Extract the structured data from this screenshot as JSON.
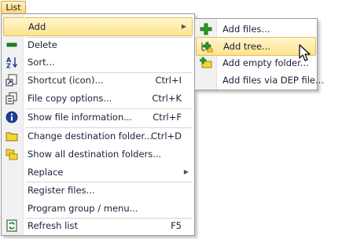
{
  "menubar": {
    "title": "List"
  },
  "menu": {
    "items": [
      {
        "label": "Add",
        "icon": "",
        "shortcut": "",
        "submenu": true,
        "highlighted": true
      },
      {
        "label": "Delete",
        "icon": "minus-icon",
        "shortcut": ""
      },
      {
        "label": "Sort...",
        "icon": "sort-az-icon",
        "shortcut": ""
      },
      {
        "label": "Shortcut (icon)...",
        "icon": "shortcut-icon",
        "shortcut": "Ctrl+I"
      },
      {
        "label": "File copy options...",
        "icon": "copy-options-icon",
        "shortcut": "Ctrl+K"
      },
      {
        "label": "Show file information...",
        "icon": "info-icon",
        "shortcut": "Ctrl+F"
      },
      {
        "label": "Change destination folder...",
        "icon": "folder-icon",
        "shortcut": "Ctrl+D"
      },
      {
        "label": "Show all destination folders...",
        "icon": "folders-icon",
        "shortcut": ""
      },
      {
        "label": "Replace",
        "icon": "",
        "shortcut": "",
        "submenu": true
      },
      {
        "label": "Register files...",
        "icon": "",
        "shortcut": ""
      },
      {
        "label": "Program group / menu...",
        "icon": "",
        "shortcut": ""
      },
      {
        "label": "Refresh list",
        "icon": "refresh-icon",
        "shortcut": "F5"
      }
    ]
  },
  "submenu": {
    "items": [
      {
        "label": "Add files...",
        "icon": "plus-icon"
      },
      {
        "label": "Add tree...",
        "icon": "add-tree-icon",
        "highlighted": true
      },
      {
        "label": "Add empty folder...",
        "icon": "add-folder-icon"
      },
      {
        "label": "Add files via DEP file...",
        "icon": ""
      }
    ]
  },
  "colors": {
    "highlight_top": "#fff6cf",
    "highlight_bottom": "#fde38d",
    "highlight_border": "#e3bf55",
    "text": "#1f1f3a",
    "gutter": "#f1f1f1"
  }
}
